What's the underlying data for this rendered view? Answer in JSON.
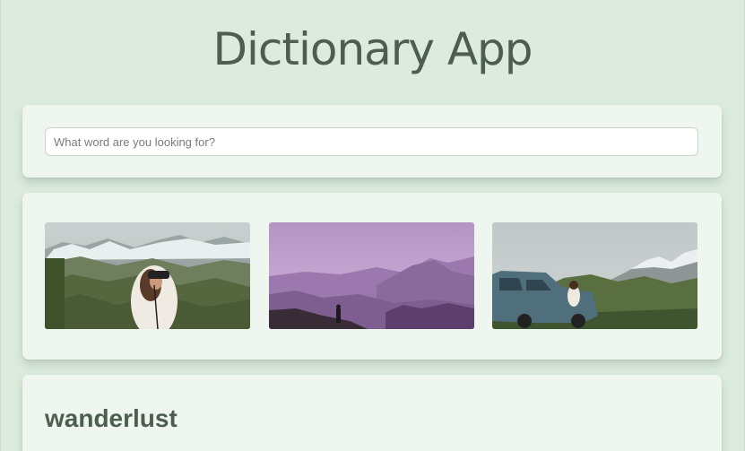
{
  "header": {
    "title": "Dictionary App"
  },
  "search": {
    "placeholder": "What word are you looking for?",
    "value": ""
  },
  "images": {
    "items": [
      {
        "icon": "photo-hiker-binoculars"
      },
      {
        "icon": "photo-purple-mountains"
      },
      {
        "icon": "photo-car-mountains"
      }
    ]
  },
  "result": {
    "word": "wanderlust"
  },
  "colors": {
    "background": "#dcebdd",
    "card": "#eef6ef",
    "text": "#4d5e51"
  }
}
